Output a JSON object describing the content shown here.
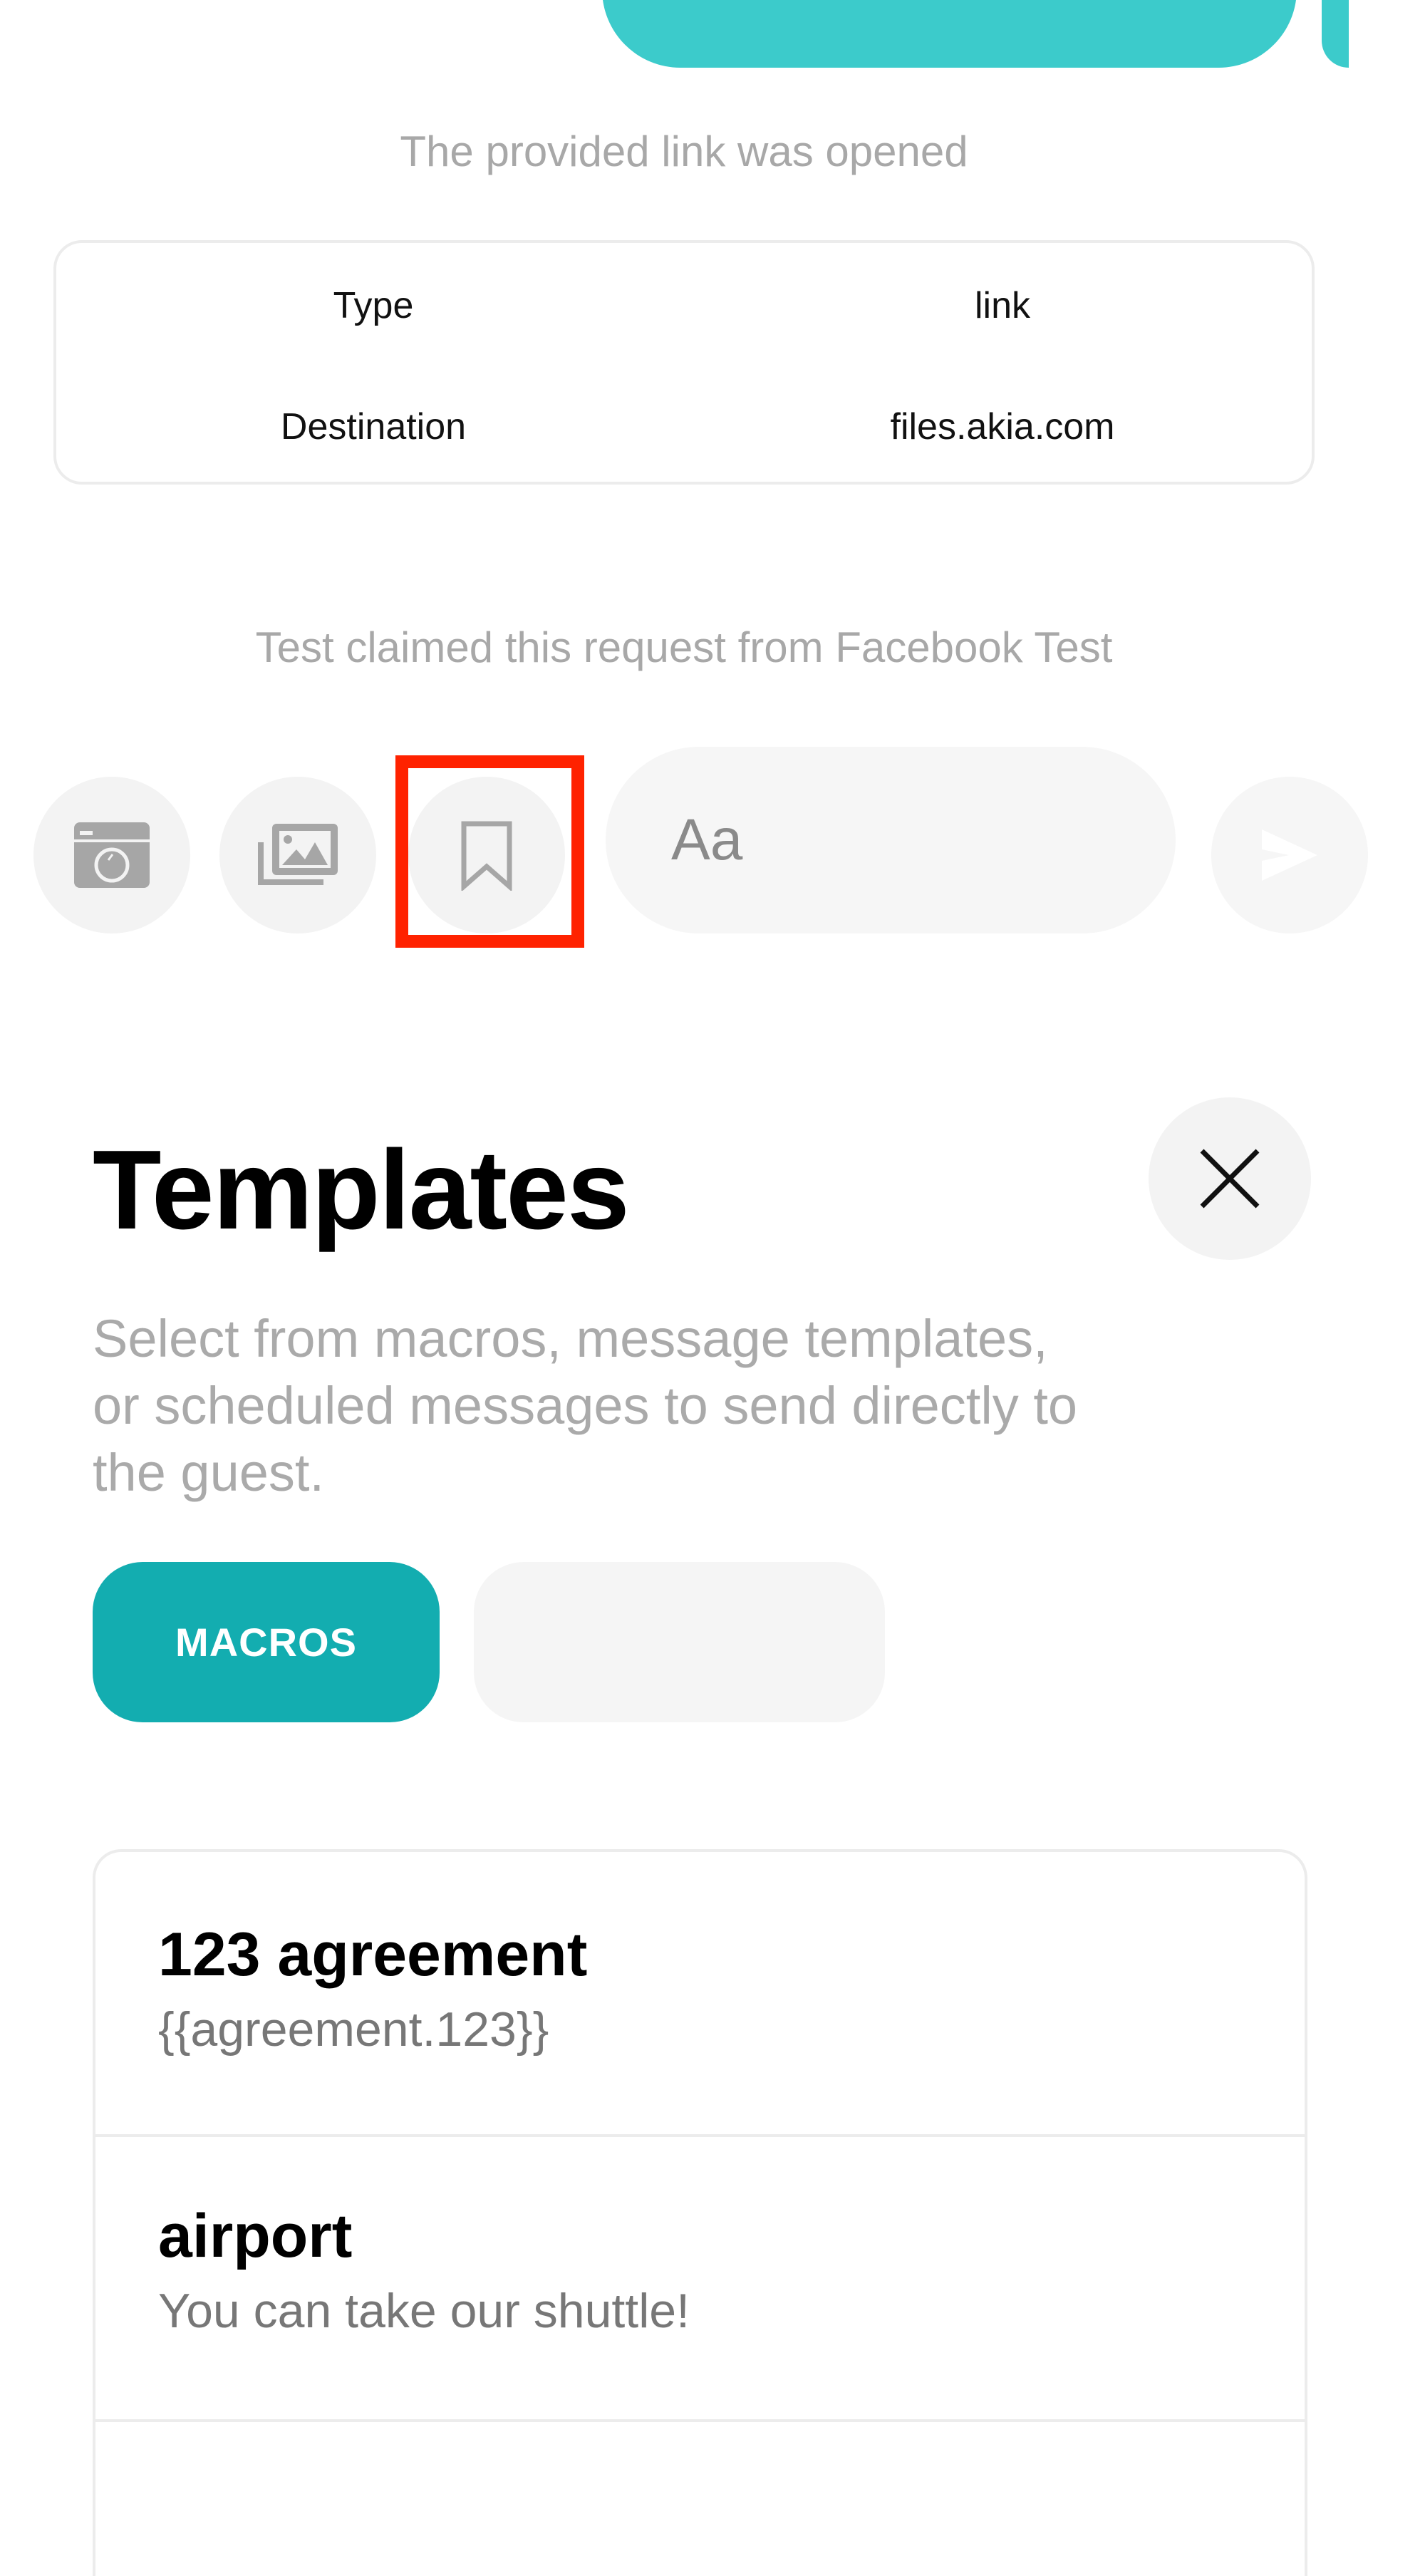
{
  "colors": {
    "accent": "#13adb0",
    "accent_light": "#3ccbcb",
    "highlight": "#ff2200"
  },
  "chat": {
    "events": [
      {
        "text": "The provided link was opened"
      },
      {
        "text": "Test claimed this request from Facebook Test"
      }
    ],
    "link_info": {
      "rows": [
        {
          "label": "Type",
          "value": "link"
        },
        {
          "label": "Destination",
          "value": "files.akia.com"
        }
      ]
    }
  },
  "composer": {
    "camera_icon": "camera-icon",
    "gallery_icon": "image-gallery-icon",
    "templates_icon": "bookmark-icon",
    "input_placeholder": "Aa",
    "send_icon": "send-icon"
  },
  "templates_panel": {
    "title": "Templates",
    "close_icon": "close-icon",
    "description": "Select from macros, message templates, or scheduled messages to send directly to the guest.",
    "tabs": [
      {
        "label": "MACROS",
        "active": true
      },
      {
        "label": "",
        "active": false
      }
    ],
    "items": [
      {
        "title": "123 agreement",
        "body": "{{agreement.123}}"
      },
      {
        "title": "airport",
        "body": "You can take our shuttle!"
      }
    ]
  }
}
